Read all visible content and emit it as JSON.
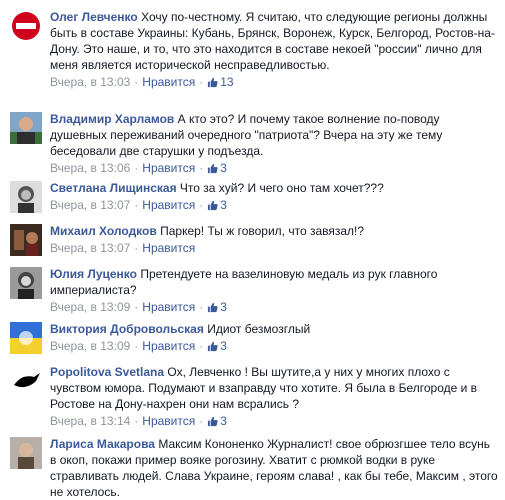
{
  "comments": [
    {
      "author": "Олег Левченко",
      "text": "Хочу по-честному. Я считаю, что следующие регионы должны быть в составе Украины: Кубань, Брянск, Воронеж, Курск, Белгород, Ростов-на-Дону. Это наше, и то, что это находится в составе некоей \"россии\" лично для меня является исторической несправедливостью.",
      "time": "Вчера, в 13:03",
      "like_label": "Нравится",
      "likes": "13",
      "avatar": "red-logo"
    },
    {
      "author": "Владимир Харламов",
      "text": "А кто это? И почему такое волнение по-поводу душевных переживаний очередного \"патриота\"? Вчера на эту же тему беседовали две старушки у подъезда.",
      "time": "Вчера, в 13:06",
      "like_label": "Нравится",
      "likes": "3",
      "avatar": "man-portrait"
    },
    {
      "author": "Светлана Лищинская",
      "text": "Что за хуй? И чего оно там хочет???",
      "time": "Вчера, в 13:07",
      "like_label": "Нравится",
      "likes": "3",
      "avatar": "woman-bw"
    },
    {
      "author": "Михаил Холодков",
      "text": "Паркер! Ты ж говорил, что завязал!?",
      "time": "Вчера, в 13:07",
      "like_label": "Нравится",
      "likes": "",
      "avatar": "dark-photo"
    },
    {
      "author": "Юлия Луценко",
      "text": "Претендуете на вазелиновую медаль из рук главного империалиста?",
      "time": "Вчера, в 13:09",
      "like_label": "Нравится",
      "likes": "3",
      "avatar": "woman-gray"
    },
    {
      "author": "Виктория Добровольская",
      "text": "Идиот безмозглый",
      "time": "Вчера, в 13:09",
      "like_label": "Нравится",
      "likes": "3",
      "avatar": "ukraine-flag"
    },
    {
      "author": "Popolitova Svetlana",
      "text": "Ох, Левченко ! Вы шутите,а у них у многих плохо с чувством юмора. Подумают и взаправду что хотите. Я была в Белгороде и в Ростове на Дону-нахрен они нам всрались ?",
      "time": "Вчера, в 13:14",
      "like_label": "Нравится",
      "likes": "3",
      "avatar": "bird-silhouette"
    },
    {
      "author": "Лариса Макарова",
      "text": "Максим Кононенко Журналист! свое обрюзгшее тело всунь в окоп, покажи пример вояке рогозину. Хватит с рюмкой водки в руке стравливать людей. Слава Украине, героям слава! , как бы тебе, Максим , этого не хотелось.",
      "time": "",
      "like_label": "",
      "likes": "",
      "avatar": "woman-photo"
    }
  ]
}
